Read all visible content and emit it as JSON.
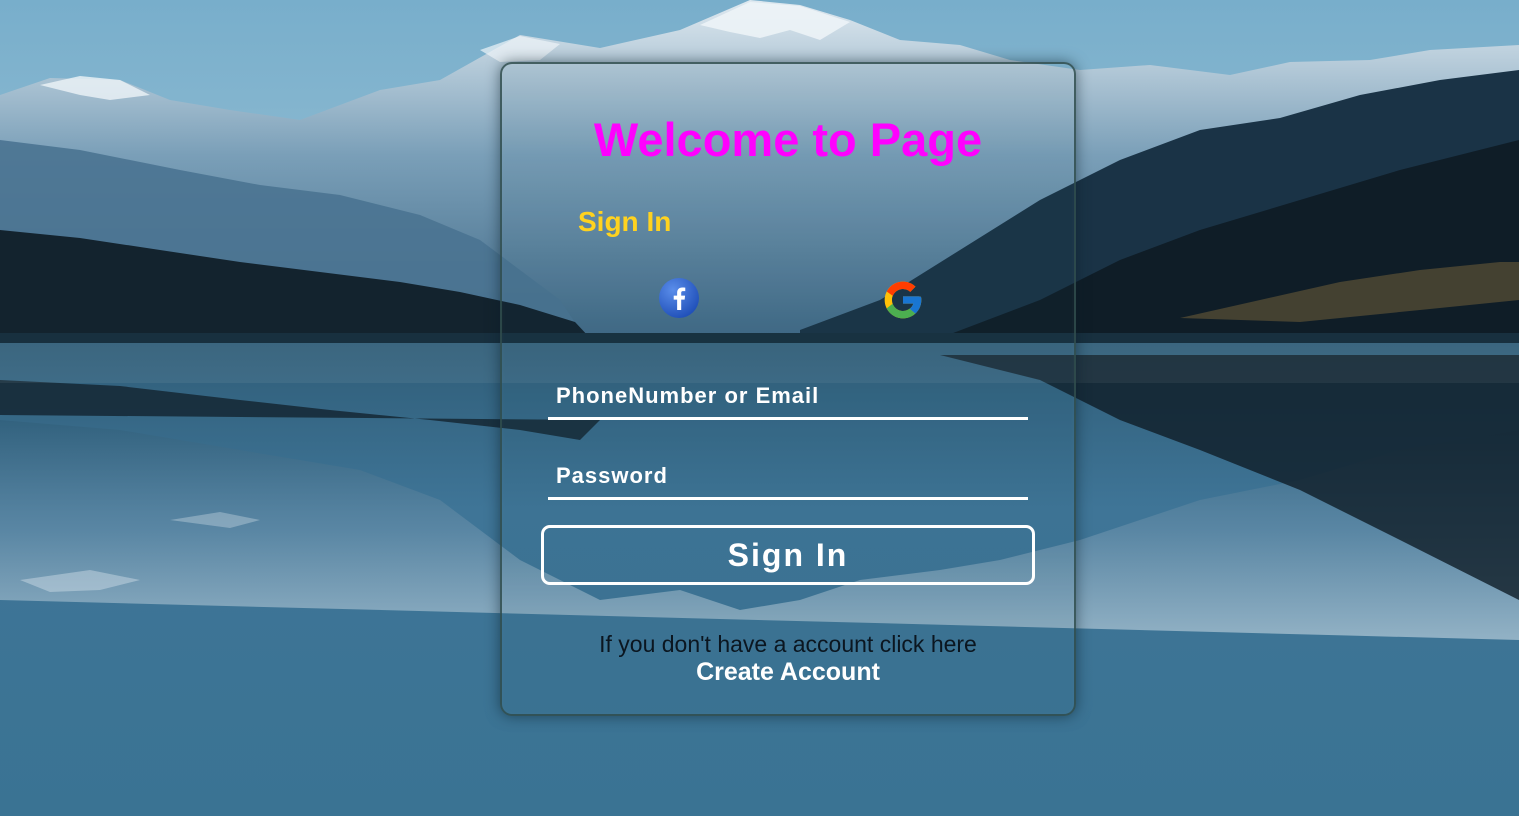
{
  "background": {
    "scene": "mountain-lake-landscape",
    "sky_color": "#6fa3c2",
    "water_color": "#3b7394",
    "forest_color": "#12202a"
  },
  "login_card": {
    "title": "Welcome to Page",
    "subtitle": "Sign In",
    "title_color": "#ff00ff",
    "subtitle_color": "#ffd21f",
    "social": {
      "facebook_icon": "facebook-icon",
      "google_icon": "google-icon"
    },
    "email_field": {
      "placeholder": "PhoneNumber or Email",
      "value": ""
    },
    "password_field": {
      "placeholder": "Password",
      "value": ""
    },
    "signin_button_label": "Sign In",
    "no_account_text": "If you don't have a account click here",
    "create_account_label": "Create Account"
  }
}
